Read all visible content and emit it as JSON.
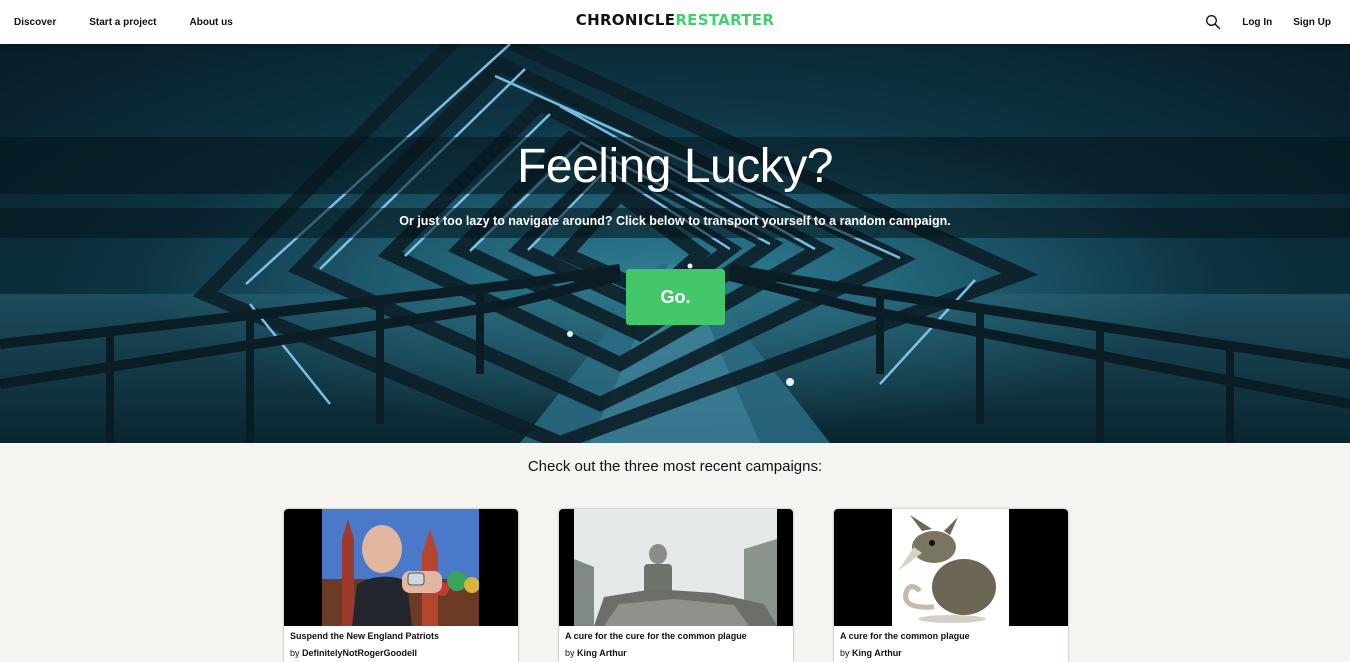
{
  "header": {
    "nav_left": [
      "Discover",
      "Start a project",
      "About us"
    ],
    "logo_part1": "CHRONICLE",
    "logo_part2": "RESTARTER",
    "login": "Log In",
    "signup": "Sign Up",
    "search_icon": "search-icon"
  },
  "hero": {
    "title": "Feeling Lucky?",
    "subtitle": "Or just too lazy to navigate around? Click below to transport yourself to a random campaign.",
    "button": "Go."
  },
  "recent": {
    "heading": "Check out the three most recent campaigns:",
    "by_prefix": "by",
    "campaigns": [
      {
        "title": "Suspend the New England Patriots",
        "author": "DefinitelyNotRogerGoodell"
      },
      {
        "title": "A cure for the cure for the common plague",
        "author": "King Arthur"
      },
      {
        "title": "A cure for the common plague",
        "author": "King Arthur"
      }
    ]
  },
  "colors": {
    "accent_green": "#44c76a",
    "logo_green": "#3fcf6e",
    "page_background": "#f5f4f0"
  }
}
